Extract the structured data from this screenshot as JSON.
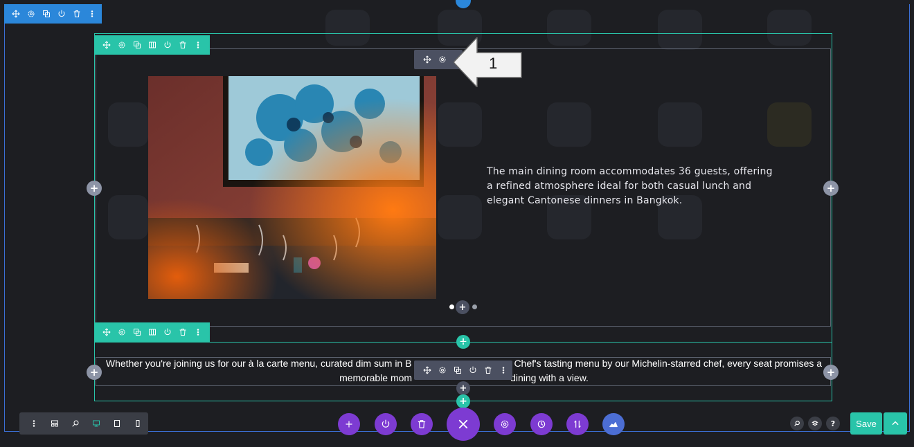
{
  "colors": {
    "section_blue": "#2b87da",
    "row_green": "#29c4a9",
    "module_grey": "#4b5061",
    "action_purple": "#7d3bd2",
    "canvas_bg": "#1d1e22"
  },
  "section_toolbar": {
    "icons": [
      "move-icon",
      "gear-icon",
      "duplicate-icon",
      "power-icon",
      "trash-icon",
      "more-icon"
    ]
  },
  "row_toolbar": {
    "icons": [
      "move-icon",
      "gear-icon",
      "duplicate-icon",
      "columns-icon",
      "power-icon",
      "trash-icon",
      "more-icon"
    ]
  },
  "module_toolbar_top": {
    "icons": [
      "move-icon",
      "gear-icon"
    ]
  },
  "module_toolbar_bottom": {
    "icons": [
      "move-icon",
      "gear-icon",
      "duplicate-icon",
      "power-icon",
      "trash-icon",
      "more-icon"
    ]
  },
  "callout": {
    "number": "1"
  },
  "main_text": "The main dining room accommodates 36 guests, offering a refined atmosphere ideal for both casual lunch and elegant Cantonese dinners in Bangkok.",
  "bottom_text": {
    "line1_left": "Whether you're joining us for our à la carte menu, curated dim sum in B",
    "line1_right": "Chef's tasting menu by our Michelin-starred chef, every seat promises a",
    "line2_left": "memorable mom",
    "line2_right": "dining with a view."
  },
  "plus": "+",
  "bottom_left_tools": {
    "icons": [
      "more-icon",
      "wireframe-icon",
      "zoom-icon",
      "desktop-icon",
      "tablet-icon",
      "phone-icon"
    ]
  },
  "bottom_center_actions": {
    "icons": [
      "add-icon",
      "power-icon",
      "trash-icon",
      "close-icon",
      "gear-icon",
      "history-icon",
      "sort-icon",
      "portability-icon"
    ]
  },
  "bottom_right": {
    "save_label": "Save",
    "help": "?"
  }
}
